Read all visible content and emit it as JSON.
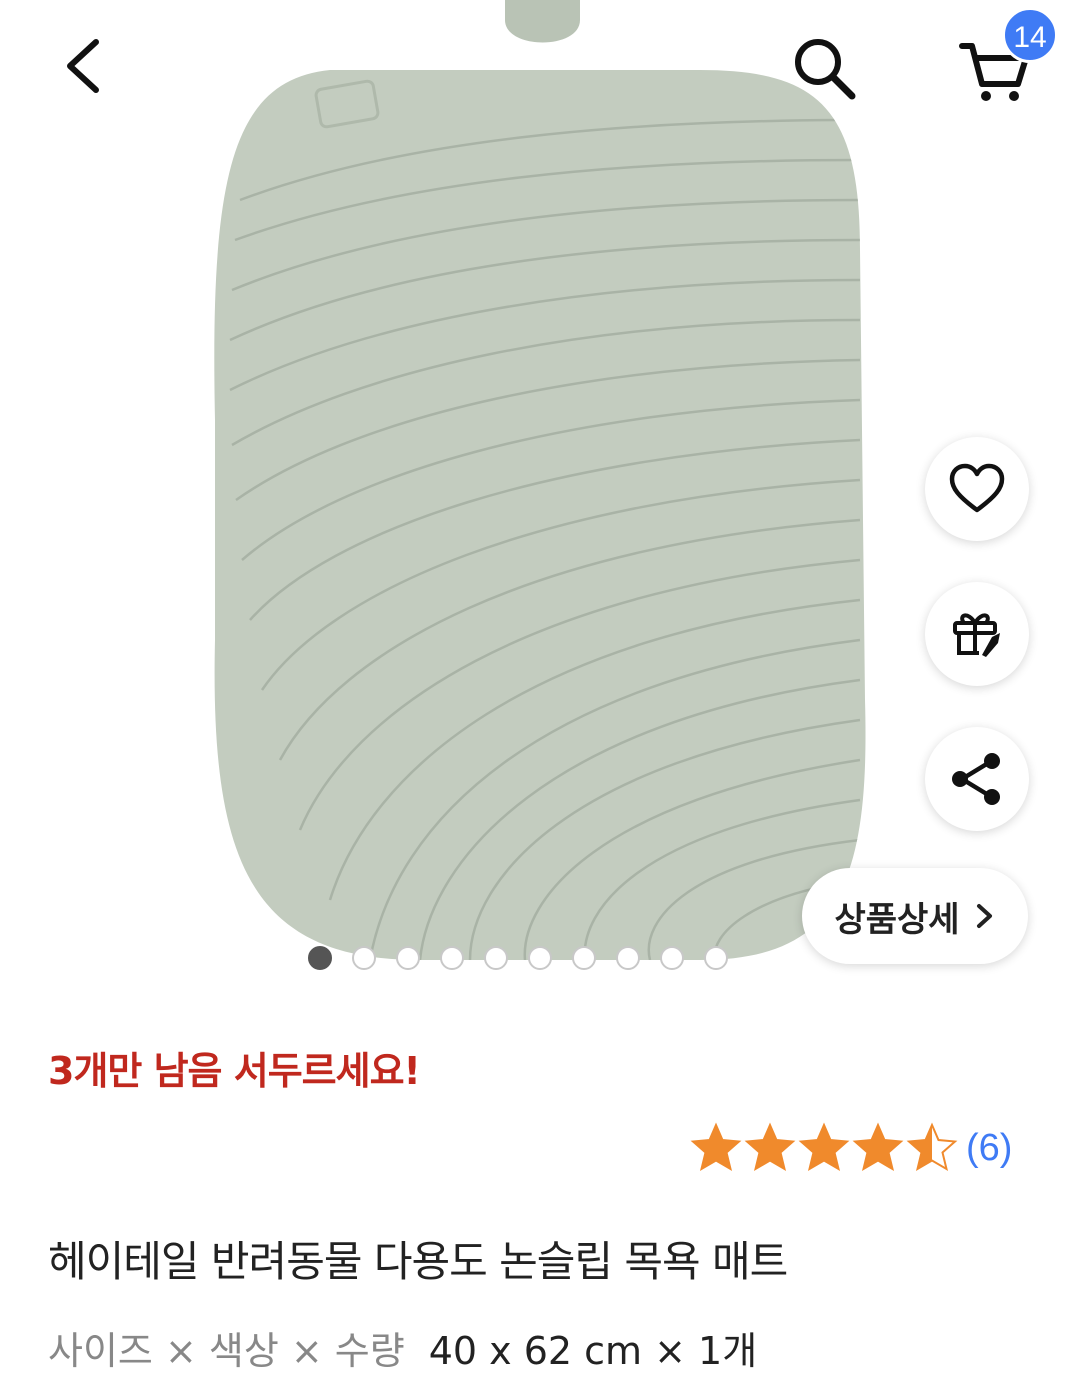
{
  "header": {
    "back_icon": "chevron-left-icon",
    "search_icon": "search-icon",
    "cart_icon": "cart-icon",
    "cart_count": "14",
    "badge_color": "#3f7bf5"
  },
  "side_actions": {
    "like_icon": "heart-icon",
    "gift_icon": "gift-icon",
    "share_icon": "share-icon",
    "detail_label": "상품상세"
  },
  "carousel": {
    "total_images": 10,
    "current_index": 1
  },
  "product": {
    "stock_notice": "3개만 남음 서두르세요!",
    "rating": 4.5,
    "review_count": "(6)",
    "title": "헤이테일 반려동물 다용도 논슬립 목욕 매트",
    "option_label": "사이즈 × 색상 × 수량",
    "option_value": "40 x 62 cm × 1개"
  },
  "colors": {
    "accent": "#3f7bf5",
    "stock_red": "#c0281e",
    "star": "#f08a2c",
    "mat": "#c3ccbf"
  }
}
